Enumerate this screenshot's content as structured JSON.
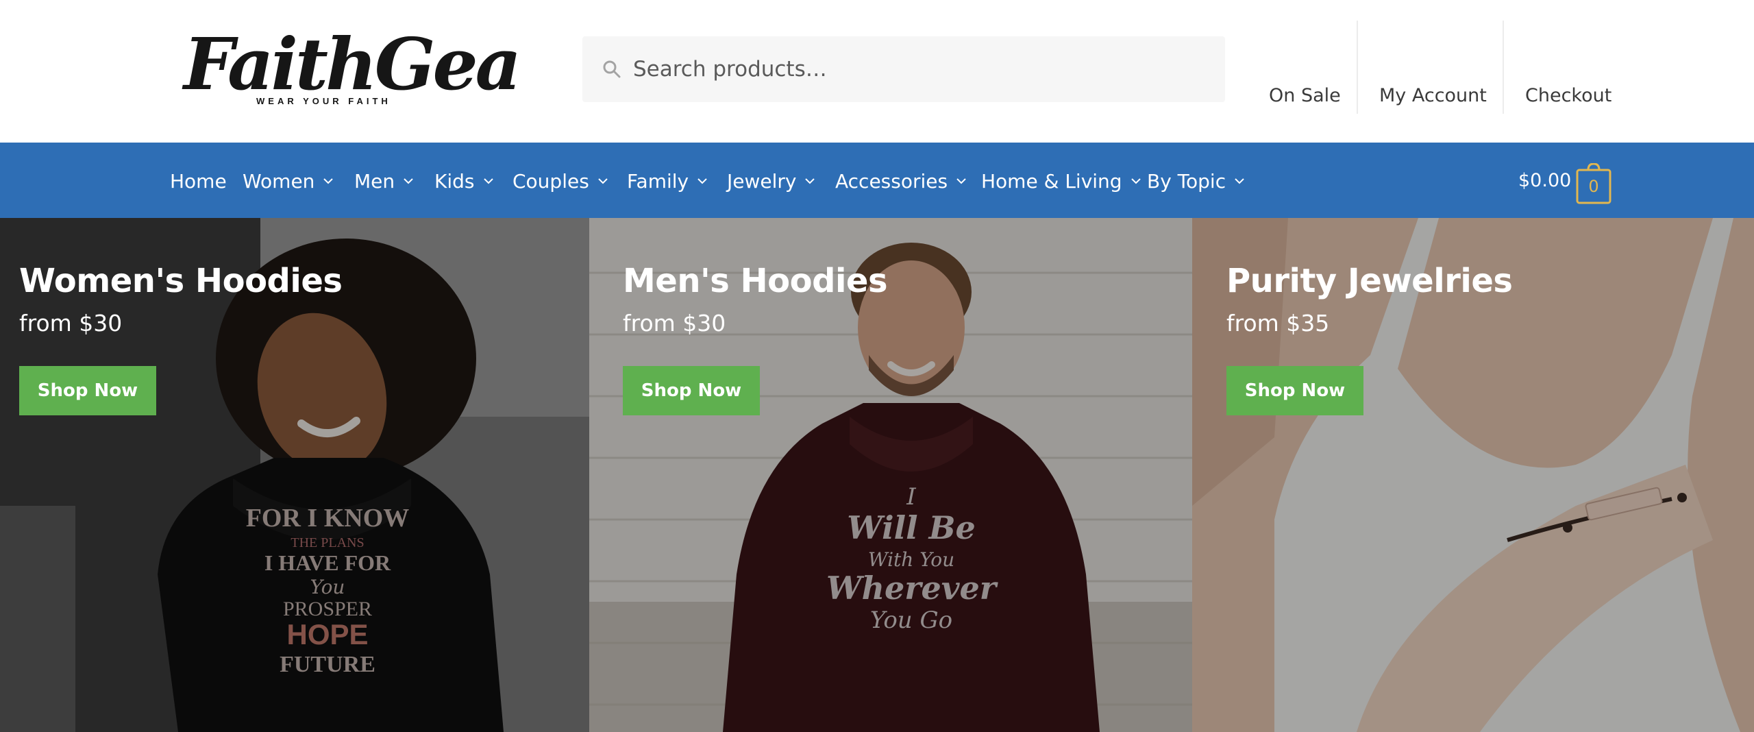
{
  "brand": {
    "logo_main": "FaithGear",
    "logo_tagline": "WEAR YOUR FAITH",
    "accent_color": "#2e6eb5",
    "button_color": "#5fb04f",
    "cart_accent_color": "#e2b74f"
  },
  "search": {
    "placeholder": "Search products…",
    "value": "",
    "icon": "search-icon"
  },
  "secondary_nav": {
    "items": [
      {
        "label": "On Sale"
      },
      {
        "label": "My Account"
      },
      {
        "label": "Checkout"
      }
    ]
  },
  "primary_nav": {
    "items": [
      {
        "label": "Home",
        "has_dropdown": false
      },
      {
        "label": "Women",
        "has_dropdown": true
      },
      {
        "label": "Men",
        "has_dropdown": true
      },
      {
        "label": "Kids",
        "has_dropdown": true
      },
      {
        "label": "Couples",
        "has_dropdown": true
      },
      {
        "label": "Family",
        "has_dropdown": true
      },
      {
        "label": "Jewelry",
        "has_dropdown": true
      },
      {
        "label": "Accessories",
        "has_dropdown": true
      },
      {
        "label": "Home & Living",
        "has_dropdown": true
      },
      {
        "label": "By Topic",
        "has_dropdown": true
      }
    ],
    "dropdown_icon": "chevron-down-icon"
  },
  "cart": {
    "total": "$0.00",
    "count": "0",
    "icon": "shopping-bag-icon"
  },
  "hero": {
    "panels": [
      {
        "title": "Women's Hoodies",
        "price": "from $30",
        "button": "Shop Now",
        "shirt_text": [
          "FOR I KNOW",
          "THE PLANS",
          "I HAVE FOR",
          "You",
          "PROSPER",
          "HOPE",
          "FUTURE"
        ]
      },
      {
        "title": "Men's Hoodies",
        "price": "from $30",
        "button": "Shop Now",
        "shirt_text": [
          "I",
          "Will Be",
          "With You",
          "Wherever",
          "You Go"
        ]
      },
      {
        "title": "Purity Jewelries",
        "price": "from $35",
        "button": "Shop Now"
      }
    ]
  }
}
